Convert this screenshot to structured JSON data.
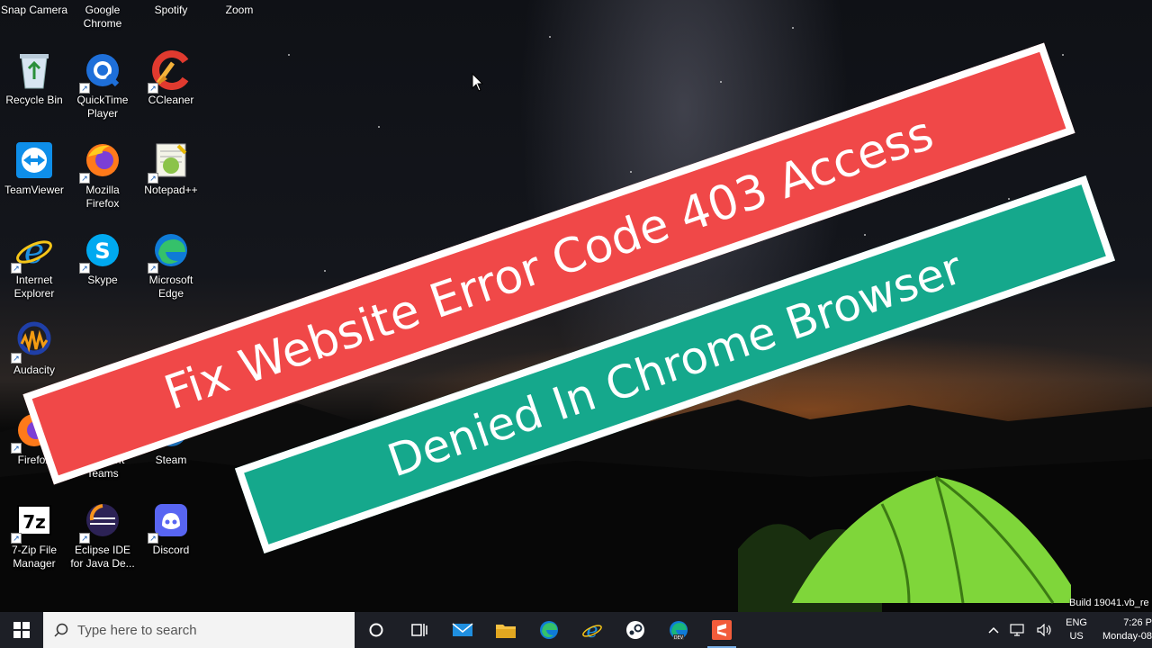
{
  "desktop": {
    "top_row_labels": [
      "Snap Camera",
      "Google Chrome",
      "Spotify",
      "Zoom"
    ],
    "icons": [
      {
        "label": "Recycle Bin",
        "icon": "recycle-bin-icon"
      },
      {
        "label": "QuickTime Player",
        "icon": "quicktime-icon"
      },
      {
        "label": "CCleaner",
        "icon": "ccleaner-icon"
      },
      {
        "label": "TeamViewer",
        "icon": "teamviewer-icon"
      },
      {
        "label": "Mozilla Firefox",
        "icon": "firefox-icon"
      },
      {
        "label": "Notepad++",
        "icon": "notepadpp-icon"
      },
      {
        "label": "Internet Explorer",
        "icon": "internet-explorer-icon"
      },
      {
        "label": "Skype",
        "icon": "skype-icon"
      },
      {
        "label": "Microsoft Edge",
        "icon": "edge-icon"
      },
      {
        "label": "Audacity",
        "icon": "audacity-icon"
      },
      {
        "label": "Firefox",
        "icon": "firefox-icon"
      },
      {
        "label": "Microsoft Teams",
        "icon": "teams-icon"
      },
      {
        "label": "Steam",
        "icon": "steam-icon"
      },
      {
        "label": "7-Zip File Manager",
        "icon": "seven-zip-icon"
      },
      {
        "label": "Eclipse IDE for Java De...",
        "icon": "eclipse-icon"
      },
      {
        "label": "Discord",
        "icon": "discord-icon"
      }
    ]
  },
  "overlay": {
    "line1": "Fix Website Error Code 403 Access",
    "line2": "Denied In Chrome Browser",
    "line1_color": "#f04848",
    "line2_color": "#15a88c"
  },
  "taskbar": {
    "search_placeholder": "Type here to search",
    "pinned": [
      "task-view-icon",
      "mail-icon",
      "file-explorer-icon",
      "edge-icon",
      "internet-explorer-icon",
      "steam-icon",
      "edge-dev-icon",
      "sublime-icon"
    ]
  },
  "tray": {
    "lang_top": "ENG",
    "lang_bottom": "US",
    "time": "7:26 P",
    "date": "Monday-08"
  },
  "watermark": {
    "build": "Build 19041.vb_re"
  }
}
